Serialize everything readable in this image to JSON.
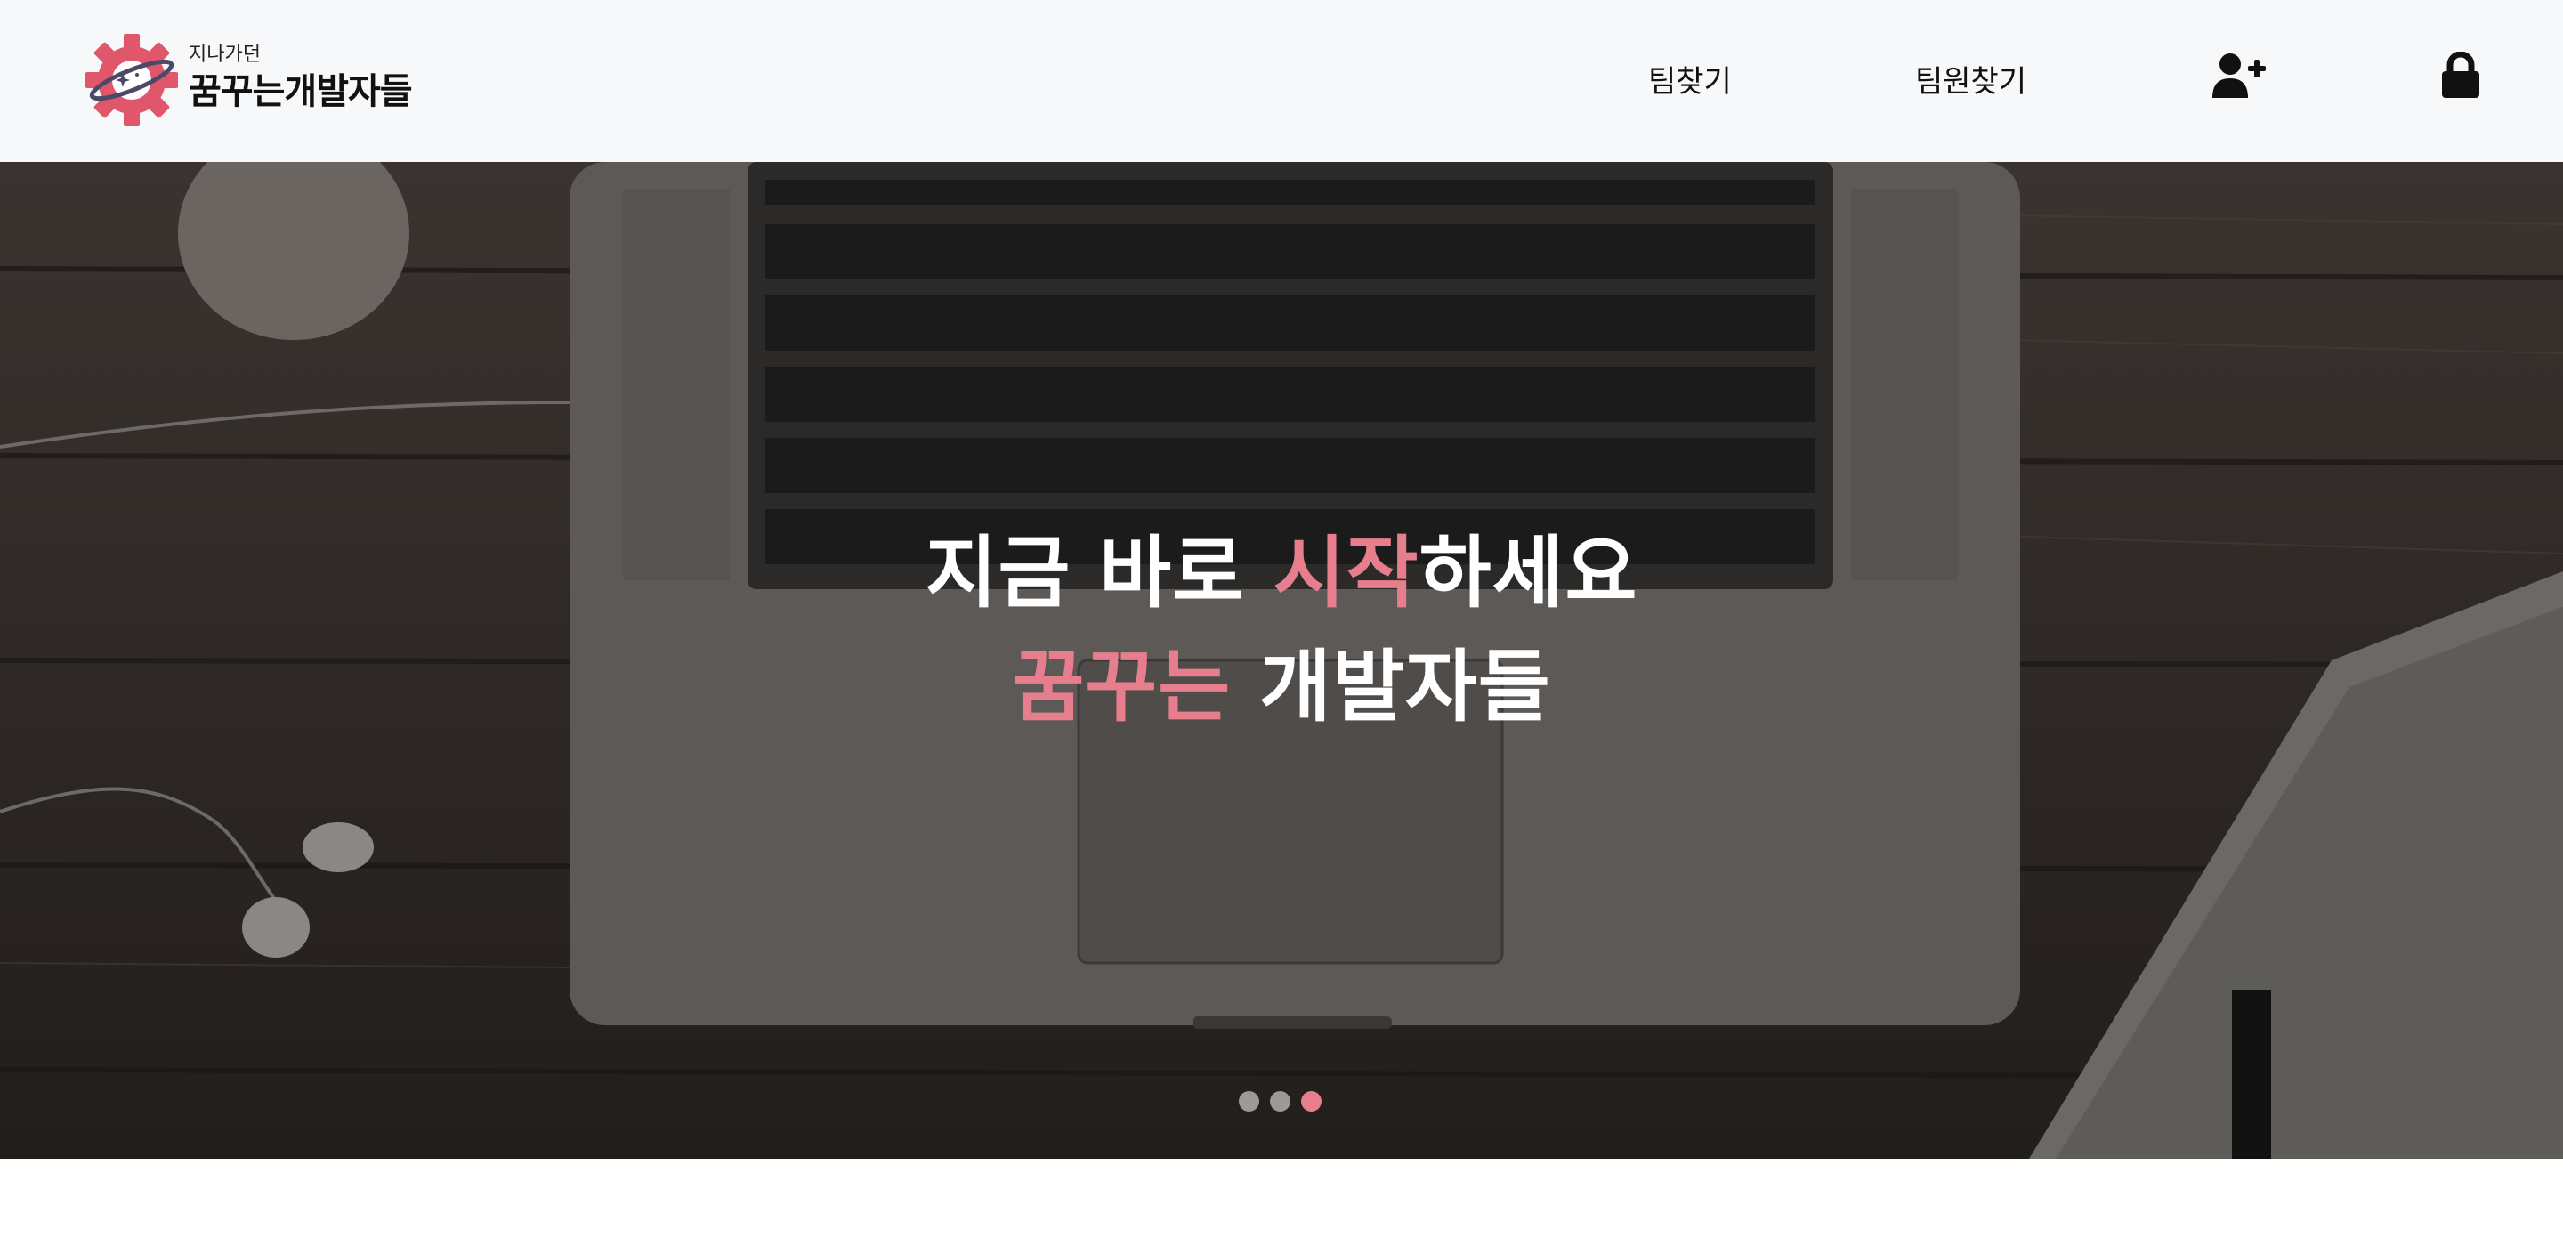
{
  "brand": {
    "subtitle": "지나가던",
    "name": "꿈꾸는개발자들",
    "mark_icon": "gear-planet-logo"
  },
  "nav": {
    "find_team": "팀찾기",
    "find_member": "팀원찾기",
    "signup_icon": "user-plus-icon",
    "login_icon": "lock-icon"
  },
  "hero": {
    "line1_pre": "지금 바로 ",
    "line1_accent": "시작",
    "line1_post": "하세요",
    "line2_accent": "꿈꾸는",
    "line2_post": " 개발자들",
    "slide_count": 3,
    "active_slide": 3
  },
  "colors": {
    "accent": "#e77e8e",
    "header_bg": "#f7f8fa",
    "dot_inactive": "#9a9a9a"
  }
}
